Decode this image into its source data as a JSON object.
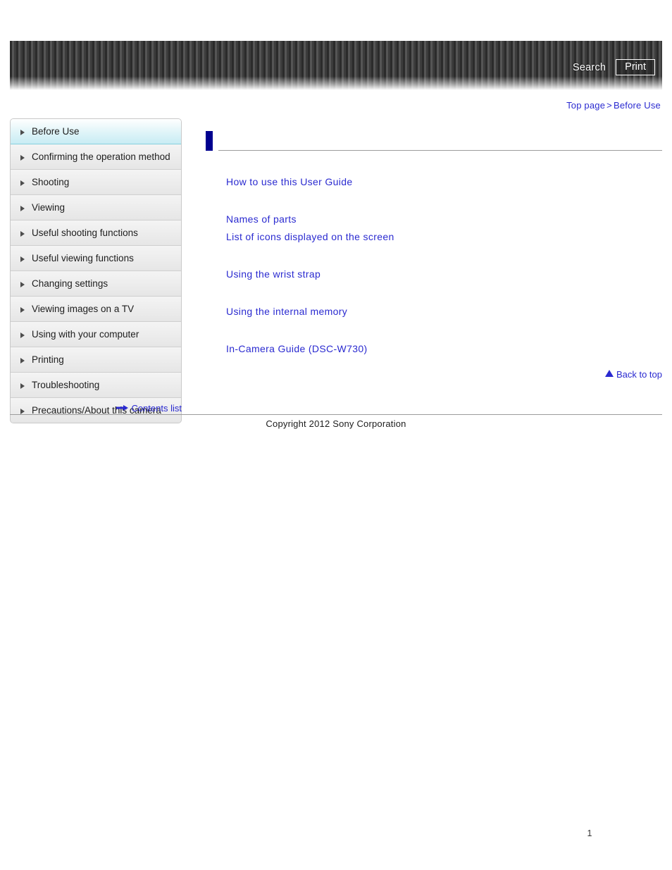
{
  "header": {
    "search_label": "Search",
    "print_label": "Print",
    "banner_color_dark": "#2b2b2b",
    "banner_color_light": "#555555"
  },
  "breadcrumb": {
    "top_page": "Top page",
    "separator": ">",
    "current": "Before Use",
    "link_color": "#2a2ad0"
  },
  "sidebar": {
    "items": [
      {
        "label": "Before Use",
        "active": true
      },
      {
        "label": "Confirming the operation method",
        "active": false
      },
      {
        "label": "Shooting",
        "active": false
      },
      {
        "label": "Viewing",
        "active": false
      },
      {
        "label": "Useful shooting functions",
        "active": false
      },
      {
        "label": "Useful viewing functions",
        "active": false
      },
      {
        "label": "Changing settings",
        "active": false
      },
      {
        "label": "Viewing images on a TV",
        "active": false
      },
      {
        "label": "Using with your computer",
        "active": false
      },
      {
        "label": "Printing",
        "active": false
      },
      {
        "label": "Troubleshooting",
        "active": false
      },
      {
        "label": "Precautions/About this camera",
        "active": false
      }
    ],
    "contents_list_label": "Contents list",
    "contents_list_icon": "arrow-right-icon",
    "active_bg_color": "#c8ecf4"
  },
  "main": {
    "page_title": "",
    "title_marker_color": "#00008f",
    "link_groups": [
      {
        "links": [
          "How to use this User Guide"
        ]
      },
      {
        "links": [
          "Names of parts",
          "List of icons displayed on the screen"
        ]
      },
      {
        "links": [
          "Using the wrist strap"
        ]
      },
      {
        "links": [
          "Using the internal memory"
        ]
      },
      {
        "links": [
          "In-Camera Guide (DSC-W730)"
        ]
      }
    ],
    "back_to_top_label": "Back to top",
    "back_to_top_icon": "triangle-up-icon"
  },
  "footer": {
    "copyright": "Copyright 2012 Sony Corporation",
    "page_number": "1"
  }
}
